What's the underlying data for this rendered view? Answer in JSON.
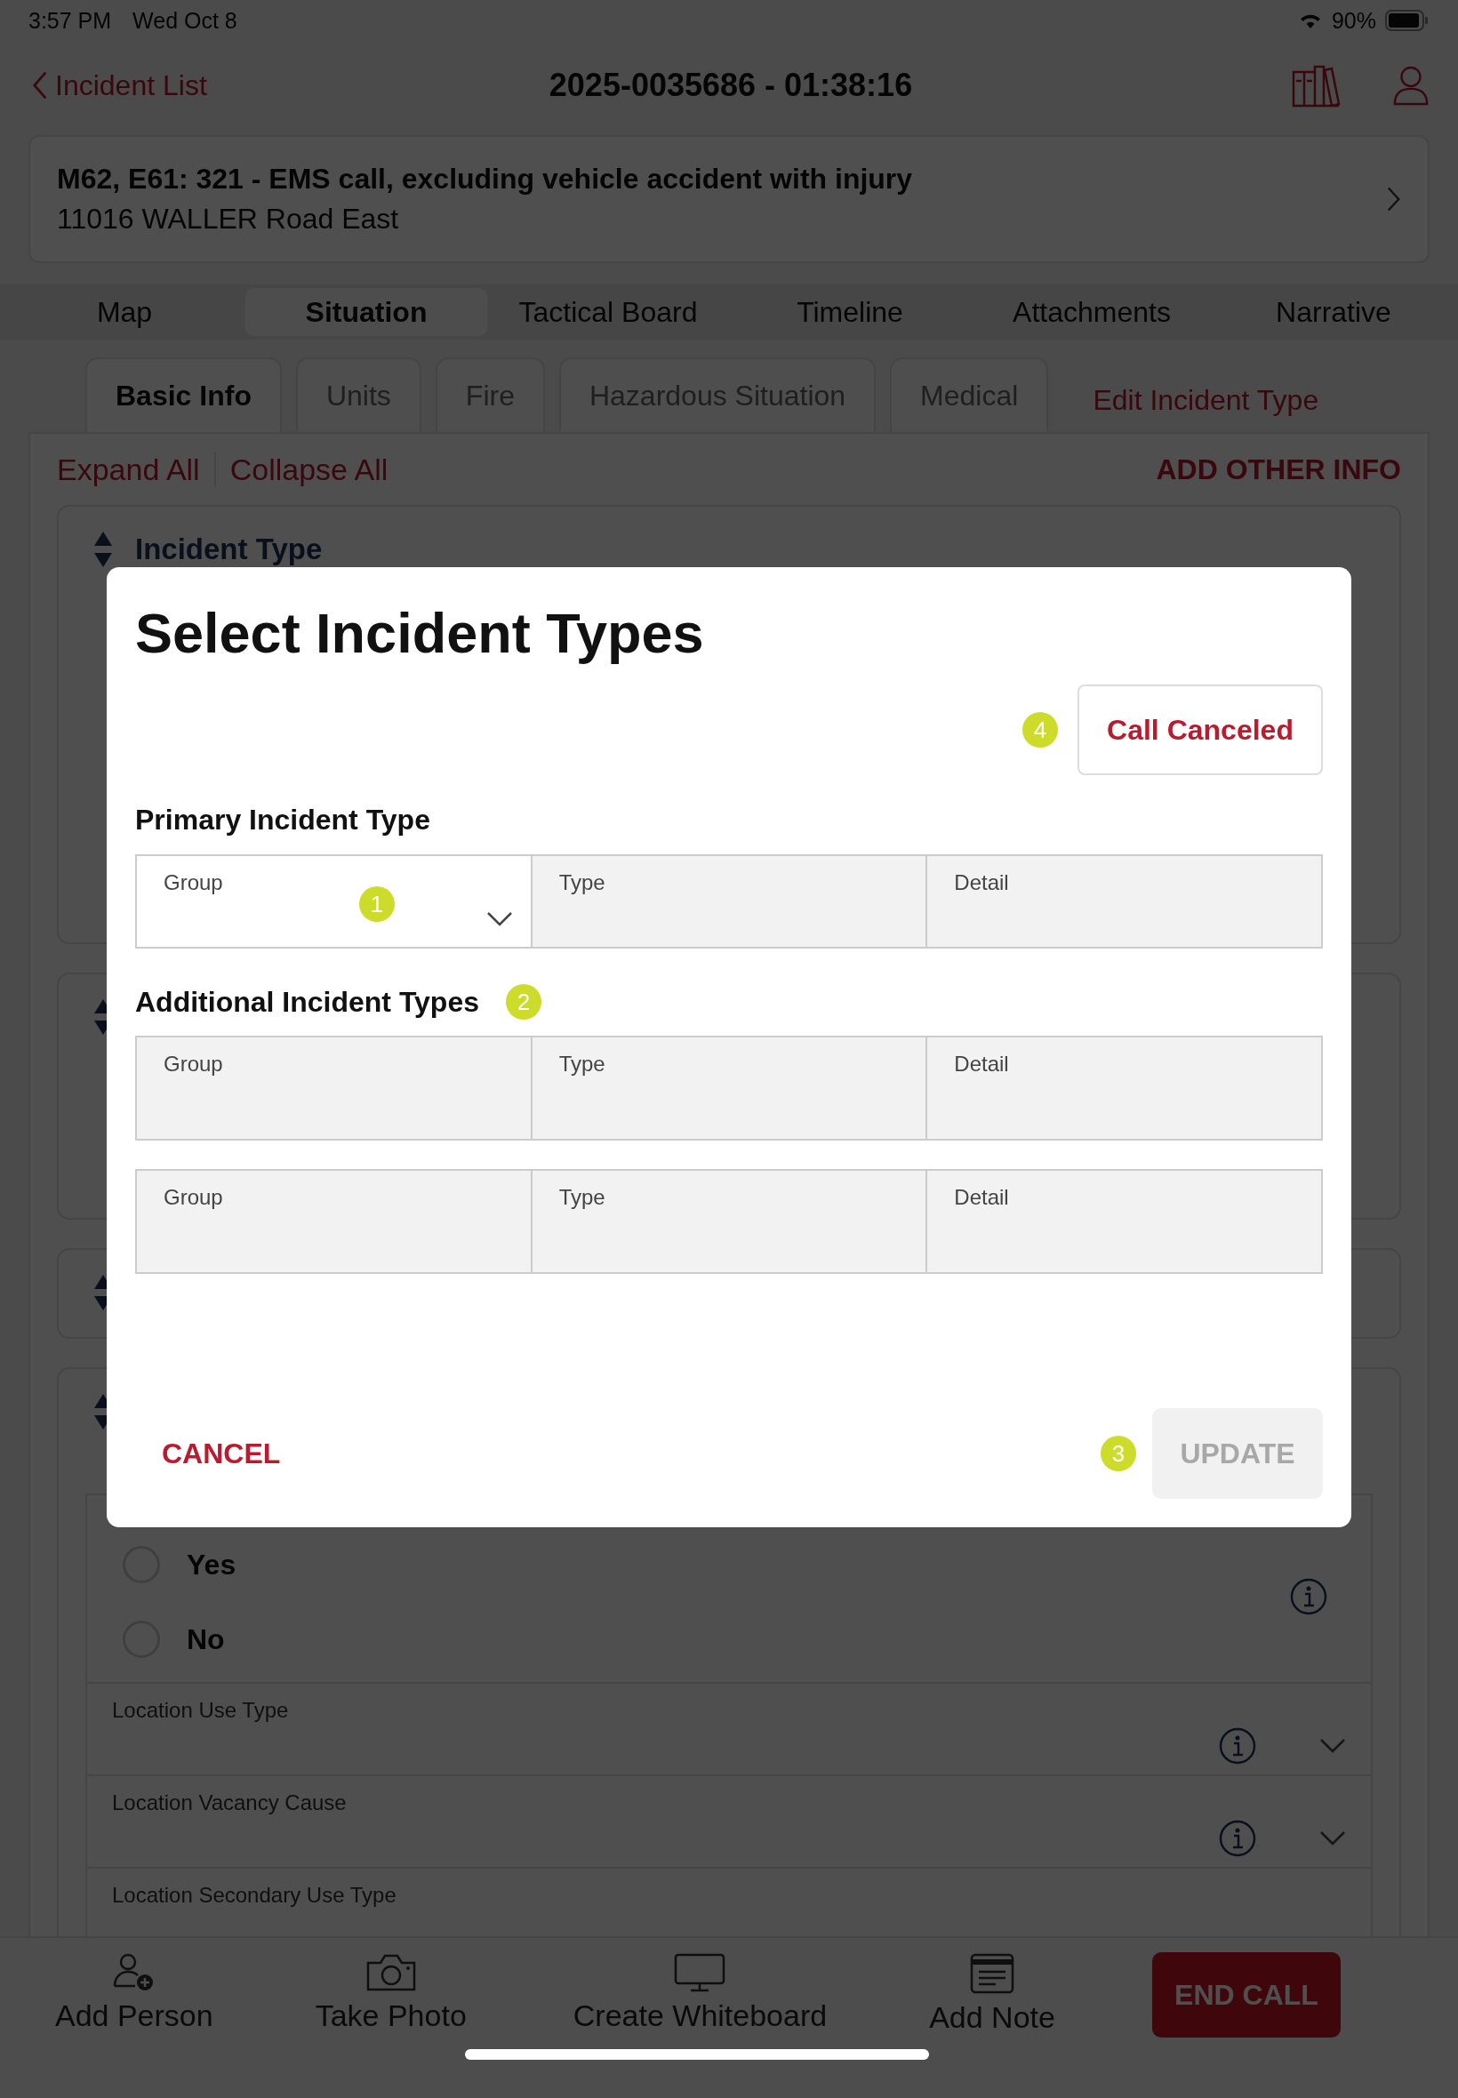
{
  "status_bar": {
    "time": "3:57 PM",
    "date": "Wed Oct 8",
    "battery": "90%"
  },
  "nav": {
    "back": "Incident List",
    "title": "2025-0035686 - 01:38:16"
  },
  "incident": {
    "title": "M62, E61: 321 - EMS call, excluding vehicle accident with injury",
    "address": "11016 WALLER Road East"
  },
  "tabs": [
    {
      "label": "Map",
      "selected": false
    },
    {
      "label": "Situation",
      "selected": true
    },
    {
      "label": "Tactical Board",
      "selected": false
    },
    {
      "label": "Timeline",
      "selected": false
    },
    {
      "label": "Attachments",
      "selected": false
    },
    {
      "label": "Narrative",
      "selected": false
    }
  ],
  "subtabs": [
    {
      "label": "Basic Info",
      "selected": true
    },
    {
      "label": "Units",
      "selected": false
    },
    {
      "label": "Fire",
      "selected": false
    },
    {
      "label": "Hazardous Situation",
      "selected": false
    },
    {
      "label": "Medical",
      "selected": false
    }
  ],
  "edit_incident_type": "Edit Incident Type",
  "expand_all": "Expand All",
  "collapse_all": "Collapse All",
  "add_other_info": "ADD OTHER INFO",
  "section_title": "Incident Type",
  "radio_options": [
    {
      "label": "Yes",
      "selected": false
    },
    {
      "label": "No",
      "selected": false
    }
  ],
  "dropdown_rows": [
    {
      "label": "Location Use Type"
    },
    {
      "label": "Location Vacancy Cause"
    },
    {
      "label": "Location Secondary Use Type"
    }
  ],
  "toolbar": [
    {
      "label": "Add Person",
      "kind": "person"
    },
    {
      "label": "Take Photo",
      "kind": "camera"
    },
    {
      "label": "Create Whiteboard",
      "kind": "monitor"
    },
    {
      "label": "Add Note",
      "kind": "note"
    }
  ],
  "end_call": "END CALL",
  "modal": {
    "title": "Select Incident Types",
    "call_canceled": "Call Canceled",
    "call_canceled_marker": "4",
    "primary_label": "Primary Incident Type",
    "primary_marker": "1",
    "primary_row": [
      {
        "label": "Group",
        "disabled": false
      },
      {
        "label": "Type",
        "disabled": true
      },
      {
        "label": "Detail",
        "disabled": true
      }
    ],
    "additional_label": "Additional Incident Types",
    "additional_marker": "2",
    "additional_rows": [
      [
        {
          "label": "Group",
          "disabled": true
        },
        {
          "label": "Type",
          "disabled": true
        },
        {
          "label": "Detail",
          "disabled": true
        }
      ],
      [
        {
          "label": "Group",
          "disabled": true
        },
        {
          "label": "Type",
          "disabled": true
        },
        {
          "label": "Detail",
          "disabled": true
        }
      ]
    ],
    "cancel": "CANCEL",
    "update": "UPDATE",
    "update_disabled": true,
    "update_marker": "3"
  }
}
